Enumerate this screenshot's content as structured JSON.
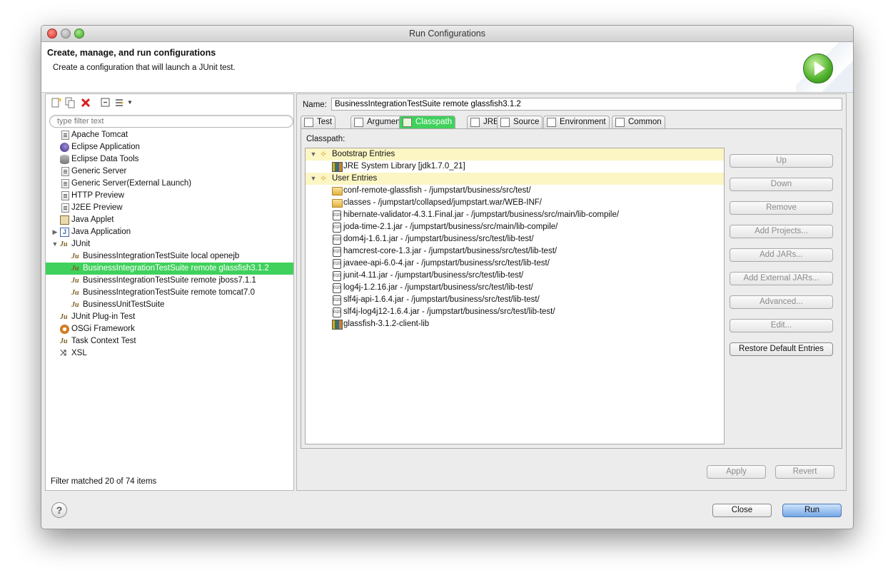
{
  "window": {
    "title": "Run Configurations"
  },
  "banner": {
    "title": "Create, manage, and run configurations",
    "subtitle": "Create a configuration that will launch a JUnit test."
  },
  "left": {
    "filter_placeholder": "type filter text",
    "status": "Filter matched 20 of 74 items",
    "tree": [
      {
        "label": "Apache Tomcat",
        "icon": "launch-file-icon",
        "level": 0
      },
      {
        "label": "Eclipse Application",
        "icon": "eclipse-icon",
        "level": 0
      },
      {
        "label": "Eclipse Data Tools",
        "icon": "database-icon",
        "level": 0
      },
      {
        "label": "Generic Server",
        "icon": "launch-file-icon",
        "level": 0
      },
      {
        "label": "Generic Server(External Launch)",
        "icon": "launch-file-icon",
        "level": 0
      },
      {
        "label": "HTTP Preview",
        "icon": "launch-file-icon",
        "level": 0
      },
      {
        "label": "J2EE Preview",
        "icon": "launch-file-icon",
        "level": 0
      },
      {
        "label": "Java Applet",
        "icon": "applet-icon",
        "level": 0
      },
      {
        "label": "Java Application",
        "icon": "java-app-icon",
        "level": 0,
        "twisty": "▶"
      },
      {
        "label": "JUnit",
        "icon": "junit-icon",
        "level": 0,
        "twisty": "▼"
      },
      {
        "label": "BusinessIntegrationTestSuite local openejb",
        "icon": "junit-icon",
        "level": 1
      },
      {
        "label": "BusinessIntegrationTestSuite remote glassfish3.1.2",
        "icon": "junit-icon",
        "level": 1,
        "selected": true
      },
      {
        "label": "BusinessIntegrationTestSuite remote jboss7.1.1",
        "icon": "junit-icon",
        "level": 1
      },
      {
        "label": "BusinessIntegrationTestSuite remote tomcat7.0",
        "icon": "junit-icon",
        "level": 1
      },
      {
        "label": "BusinessUnitTestSuite",
        "icon": "junit-icon",
        "level": 1
      },
      {
        "label": "JUnit Plug-in Test",
        "icon": "junit-plugin-icon",
        "level": 0
      },
      {
        "label": "OSGi Framework",
        "icon": "osgi-icon",
        "level": 0
      },
      {
        "label": "Task Context Test",
        "icon": "junit-icon",
        "level": 0
      },
      {
        "label": "XSL",
        "icon": "xsl-icon",
        "level": 0
      }
    ]
  },
  "right": {
    "name_label": "Name:",
    "name_value": "BusinessIntegrationTestSuite remote glassfish3.1.2",
    "tabs": [
      {
        "label": "Test",
        "icon": "test-tab-icon"
      },
      {
        "label": "Arguments",
        "icon": "arguments-tab-icon"
      },
      {
        "label": "Classpath",
        "icon": "classpath-tab-icon",
        "active": true
      },
      {
        "label": "JRE",
        "icon": "jre-tab-icon"
      },
      {
        "label": "Source",
        "icon": "source-tab-icon"
      },
      {
        "label": "Environment",
        "icon": "environment-tab-icon"
      },
      {
        "label": "Common",
        "icon": "common-tab-icon"
      }
    ],
    "classpath_label": "Classpath:",
    "classpath": [
      {
        "label": "Bootstrap Entries",
        "kind": "group",
        "highlight": true
      },
      {
        "label": "JRE System Library [jdk1.7.0_21]",
        "kind": "lib"
      },
      {
        "label": "User Entries",
        "kind": "group",
        "highlight": true
      },
      {
        "label": "conf-remote-glassfish - /jumpstart/business/src/test/",
        "kind": "folder"
      },
      {
        "label": "classes - /jumpstart/collapsed/jumpstart.war/WEB-INF/",
        "kind": "folder"
      },
      {
        "label": "hibernate-validator-4.3.1.Final.jar - /jumpstart/business/src/main/lib-compile/",
        "kind": "jar"
      },
      {
        "label": "joda-time-2.1.jar - /jumpstart/business/src/main/lib-compile/",
        "kind": "jar"
      },
      {
        "label": "dom4j-1.6.1.jar - /jumpstart/business/src/test/lib-test/",
        "kind": "jar"
      },
      {
        "label": "hamcrest-core-1.3.jar - /jumpstart/business/src/test/lib-test/",
        "kind": "jar"
      },
      {
        "label": "javaee-api-6.0-4.jar - /jumpstart/business/src/test/lib-test/",
        "kind": "jar"
      },
      {
        "label": "junit-4.11.jar - /jumpstart/business/src/test/lib-test/",
        "kind": "jar"
      },
      {
        "label": "log4j-1.2.16.jar - /jumpstart/business/src/test/lib-test/",
        "kind": "jar"
      },
      {
        "label": "slf4j-api-1.6.4.jar - /jumpstart/business/src/test/lib-test/",
        "kind": "jar"
      },
      {
        "label": "slf4j-log4j12-1.6.4.jar - /jumpstart/business/src/test/lib-test/",
        "kind": "jar"
      },
      {
        "label": "glassfish-3.1.2-client-lib",
        "kind": "lib"
      }
    ],
    "side_buttons": [
      {
        "label": "Up",
        "enabled": false
      },
      {
        "label": "Down",
        "enabled": false
      },
      {
        "label": "Remove",
        "enabled": false
      },
      {
        "label": "Add Projects...",
        "enabled": false
      },
      {
        "label": "Add JARs...",
        "enabled": false
      },
      {
        "label": "Add External JARs...",
        "enabled": false
      },
      {
        "label": "Advanced...",
        "enabled": false
      },
      {
        "label": "Edit...",
        "enabled": false
      },
      {
        "label": "Restore Default Entries",
        "enabled": true
      }
    ],
    "apply": "Apply",
    "revert": "Revert"
  },
  "footer": {
    "help": "?",
    "close": "Close",
    "run": "Run"
  },
  "colors": {
    "selection": "#3fd15c",
    "highlight": "#fbf6c4",
    "run_button": "#74a7e6"
  }
}
